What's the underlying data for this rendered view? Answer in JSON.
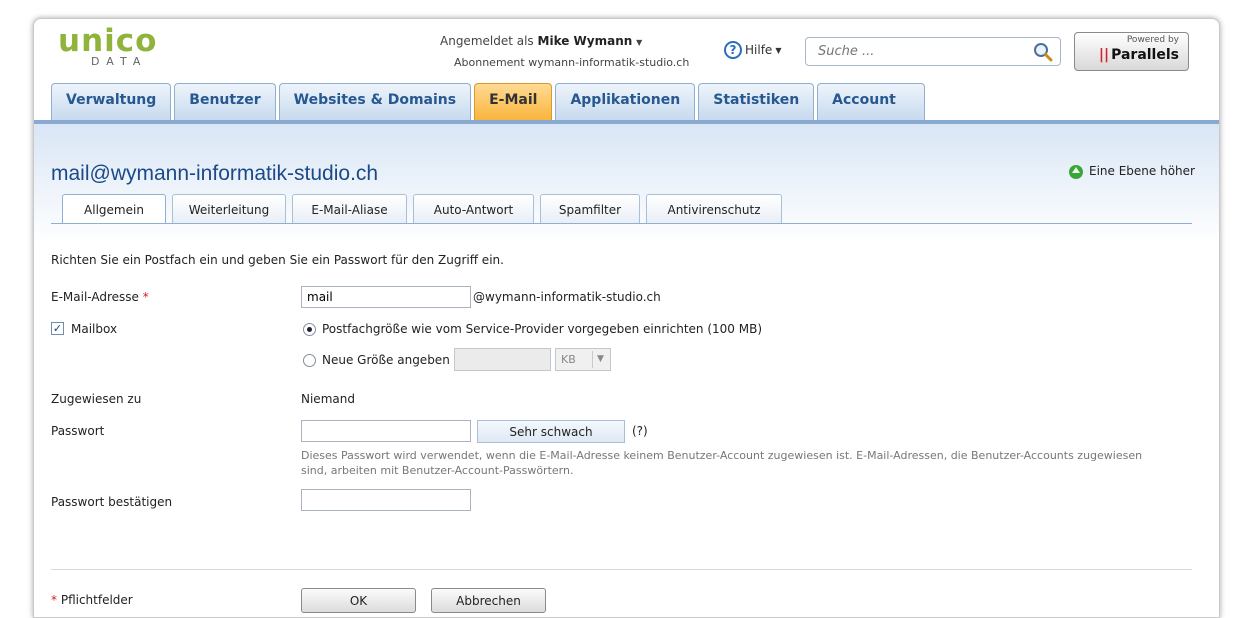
{
  "header": {
    "logo_text": "unico",
    "logo_sub": "DATA",
    "logged_in_prefix": "Angemeldet als",
    "user_name": "Mike Wymann",
    "subscription": "Abonnement wymann-informatik-studio.ch",
    "help_label": "Hilfe",
    "search_placeholder": "Suche ...",
    "powered_by": "Powered by",
    "brand": "Parallels"
  },
  "main_tabs": [
    "Verwaltung",
    "Benutzer",
    "Websites & Domains",
    "E-Mail",
    "Applikationen",
    "Statistiken",
    "Account"
  ],
  "active_main_tab": "E-Mail",
  "page": {
    "title": "mail@wymann-informatik-studio.ch",
    "up_level": "Eine Ebene höher"
  },
  "sub_tabs": [
    "Allgemein",
    "Weiterleitung",
    "E-Mail-Aliase",
    "Auto-Antwort",
    "Spamfilter",
    "Antivirenschutz"
  ],
  "active_sub_tab": "Allgemein",
  "form": {
    "intro": "Richten Sie ein Postfach ein und geben Sie ein Passwort für den Zugriff ein.",
    "email_label": "E-Mail-Adresse",
    "required_mark": "*",
    "email_value": "mail",
    "email_domain": "@wymann-informatik-studio.ch",
    "mailbox_label": "Mailbox",
    "mailbox_checked": true,
    "radio_default": "Postfachgröße wie vom Service-Provider vorgegeben einrichten (100 MB)",
    "radio_custom": "Neue Größe angeben",
    "size_unit": "KB",
    "assigned_label": "Zugewiesen zu",
    "assigned_value": "Niemand",
    "password_label": "Passwort",
    "password_strength": "Sehr schwach",
    "password_help": "(?)",
    "password_hint": "Dieses Passwort wird verwendet, wenn die E-Mail-Adresse keinem Benutzer-Account zugewiesen ist. E-Mail-Adressen, die Benutzer-Accounts zugewiesen sind, arbeiten mit Benutzer-Account-Passwörtern.",
    "confirm_label": "Passwort bestätigen",
    "required_note": "Pflichtfelder",
    "ok": "OK",
    "cancel": "Abbrechen"
  },
  "colors": {
    "tab_active": "#f9b33a",
    "tab_text": "#27588f",
    "title_blue": "#1a4a8a",
    "logo_green": "#8fb33b",
    "required_red": "#d42020"
  }
}
